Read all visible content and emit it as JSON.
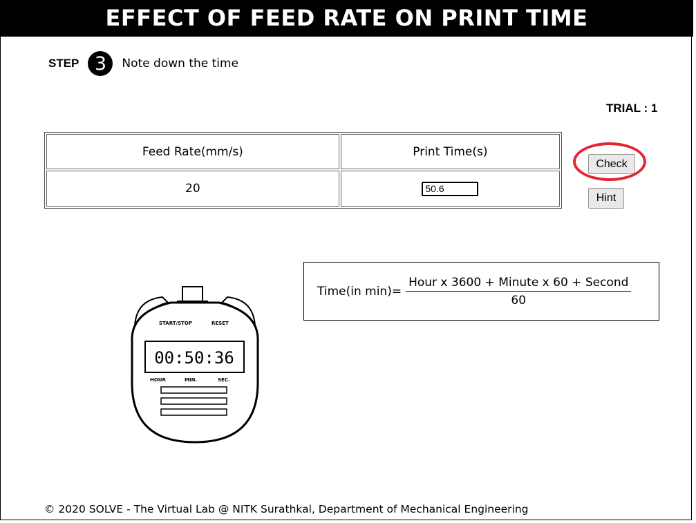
{
  "title": "EFFECT OF FEED RATE ON PRINT TIME",
  "step": {
    "label": "STEP",
    "number": "3",
    "instruction": "Note down the time"
  },
  "trial": "TRIAL : 1",
  "table": {
    "headers": [
      "Feed Rate(mm/s)",
      "Print Time(s)"
    ],
    "feed_rate": "20",
    "print_time_value": "50.6"
  },
  "buttons": {
    "check": "Check",
    "hint": "Hint"
  },
  "formula": {
    "lhs": "Time(in min)=",
    "numerator": "Hour x 3600 + Minute x 60 + Second",
    "denominator": "60"
  },
  "stopwatch": {
    "display": "00:50:36",
    "label_start_stop": "START/STOP",
    "label_reset": "RESET",
    "label_hour": "HOUR",
    "label_min": "MIN.",
    "label_sec": "SEC."
  },
  "footer": "© 2020 SOLVE - The Virtual Lab @ NITK Surathkal, Department of Mechanical Engineering",
  "colors": {
    "title_bg": "#000000",
    "highlight": "#e3262f"
  }
}
